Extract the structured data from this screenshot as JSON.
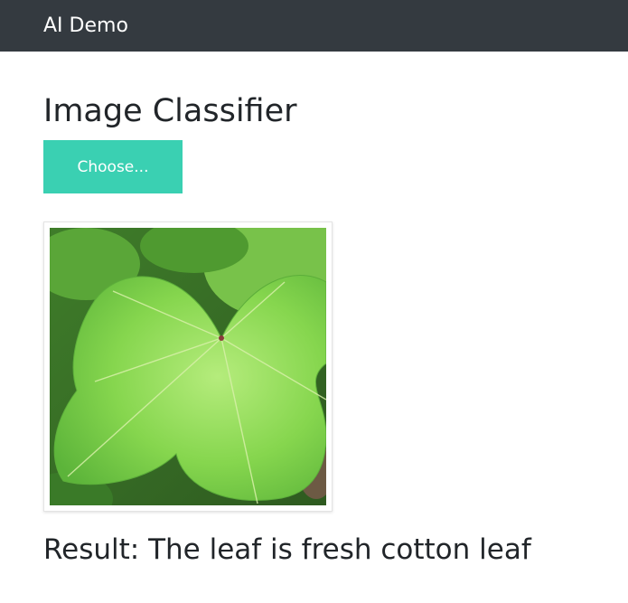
{
  "navbar": {
    "brand": "AI Demo"
  },
  "main": {
    "title": "Image Classifier",
    "choose_button_label": "Choose...",
    "result_text": "Result: The leaf is fresh cotton leaf"
  },
  "colors": {
    "navbar_bg": "#343a40",
    "button_bg": "#3ad0b2",
    "leaf_green": "#7ccf4a"
  }
}
